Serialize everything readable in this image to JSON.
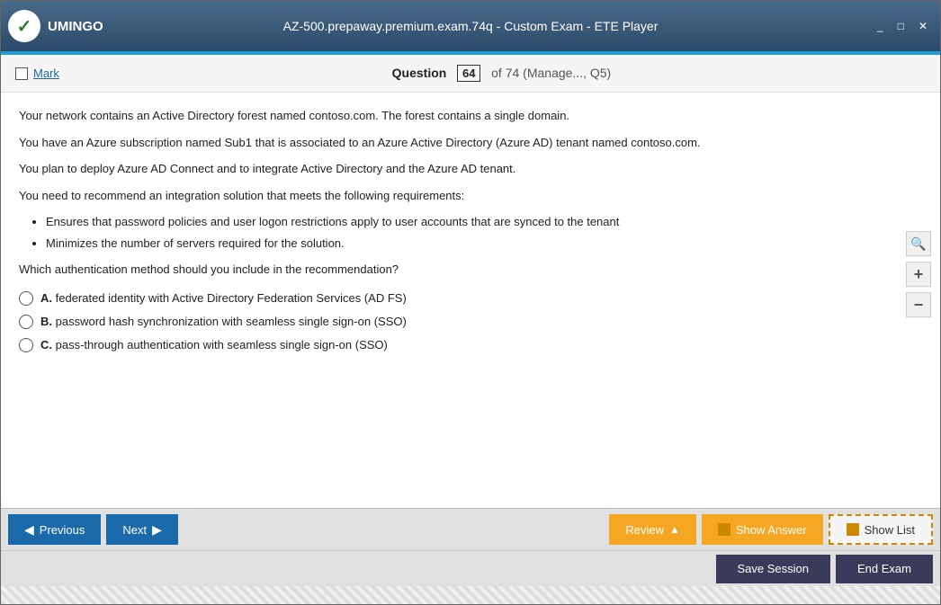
{
  "titleBar": {
    "title": "AZ-500.prepaway.premium.exam.74q - Custom Exam - ETE Player",
    "logoText": "UMINGO",
    "controls": [
      "_",
      "□",
      "✕"
    ]
  },
  "questionHeader": {
    "markLabel": "Mark",
    "questionLabel": "Question",
    "questionNumber": "64",
    "ofLabel": "of 74 (Manage..., Q5)"
  },
  "content": {
    "paragraphs": [
      "Your network contains an Active Directory forest named contoso.com. The forest contains a single domain.",
      "You have an Azure subscription named Sub1 that is associated to an Azure Active Directory (Azure AD) tenant named contoso.com.",
      "You plan to deploy Azure AD Connect and to integrate Active Directory and the Azure AD tenant.",
      "You need to recommend an integration solution that meets the following requirements:"
    ],
    "bullets": [
      "Ensures that password policies and user logon restrictions apply to user accounts that are synced to the tenant",
      "Minimizes the number of servers required for the solution."
    ],
    "questionPrompt": "Which authentication method should you include in the recommendation?",
    "options": [
      {
        "id": "A",
        "text": "federated identity with Active Directory Federation Services (AD FS)"
      },
      {
        "id": "B",
        "text": "password hash synchronization with seamless single sign-on (SSO)"
      },
      {
        "id": "C",
        "text": "pass-through authentication with seamless single sign-on (SSO)"
      }
    ]
  },
  "sidebarIcons": {
    "search": "🔍",
    "zoomIn": "+",
    "zoomOut": "−"
  },
  "toolbar": {
    "previousLabel": "Previous",
    "nextLabel": "Next",
    "reviewLabel": "Review",
    "showAnswerLabel": "Show Answer",
    "showListLabel": "Show List",
    "saveSessionLabel": "Save Session",
    "endExamLabel": "End Exam"
  }
}
